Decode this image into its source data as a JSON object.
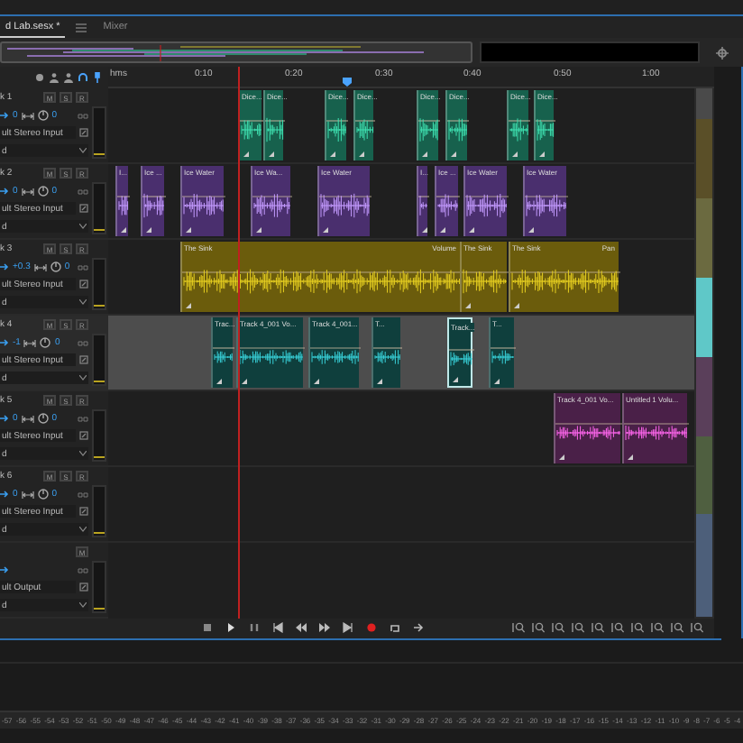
{
  "tabs": [
    {
      "label": "d Lab.sesx *",
      "selected": true
    },
    {
      "label": "Mixer",
      "selected": false
    }
  ],
  "ruler": [
    "hms",
    "0:10",
    "0:20",
    "0:30",
    "0:40",
    "0:50",
    "1:00"
  ],
  "tracks": [
    {
      "name": "k 1",
      "volume": "0",
      "pan": "0",
      "input": "ult Stereo Input",
      "mode": "d",
      "buttons": [
        "M",
        "S",
        "R"
      ],
      "color": "#17614d",
      "selected": false,
      "clips": [
        {
          "label": "Dice..."
        },
        {
          "label": "Dice..."
        },
        {
          "label": "Dice..."
        },
        {
          "label": "Dice..."
        },
        {
          "label": "Dice..."
        },
        {
          "label": "Dice..."
        },
        {
          "label": "Dice..."
        },
        {
          "label": "Dice..."
        }
      ]
    },
    {
      "name": "k 2",
      "volume": "0",
      "pan": "0",
      "input": "ult Stereo Input",
      "mode": "d",
      "buttons": [
        "M",
        "S",
        "R"
      ],
      "color": "#4a2f6e",
      "selected": false,
      "clips": [
        {
          "label": "I..."
        },
        {
          "label": "Ice ..."
        },
        {
          "label": "Ice Water"
        },
        {
          "label": "Ice Wa..."
        },
        {
          "label": "Ice Water"
        },
        {
          "label": "I..."
        },
        {
          "label": "Ice ..."
        },
        {
          "label": "Ice Water"
        },
        {
          "label": "Ice Water"
        }
      ]
    },
    {
      "name": "k 3",
      "volume": "+0.3",
      "pan": "0",
      "input": "ult Stereo Input",
      "mode": "d",
      "buttons": [
        "M",
        "S",
        "R"
      ],
      "color": "#6b5c0c",
      "selected": false,
      "clips": [
        {
          "label": "The Sink",
          "effect": "Volume"
        },
        {
          "label": "The Sink"
        },
        {
          "label": "The Sink",
          "effect": "Pan"
        }
      ]
    },
    {
      "name": "k 4",
      "volume": "-1",
      "pan": "0",
      "input": "ult Stereo Input",
      "mode": "d",
      "buttons": [
        "M",
        "S",
        "R"
      ],
      "color": "#0f3f3d",
      "selected": true,
      "clips": [
        {
          "label": "Trac..."
        },
        {
          "label": "Track 4_001 Vo..."
        },
        {
          "label": "Track 4_001..."
        },
        {
          "label": "T..."
        },
        {
          "label": "Track...",
          "selected": true
        },
        {
          "label": "T..."
        }
      ]
    },
    {
      "name": "k 5",
      "volume": "0",
      "pan": "0",
      "input": "ult Stereo Input",
      "mode": "d",
      "buttons": [
        "M",
        "S",
        "R"
      ],
      "color": "#4a2048",
      "selected": false,
      "clips": [
        {
          "label": "Track 4_001 Vo..."
        },
        {
          "label": "Untitled 1 Volu..."
        }
      ]
    },
    {
      "name": "k 6",
      "volume": "0",
      "pan": "0",
      "input": "ult Stereo Input",
      "mode": "d",
      "buttons": [
        "M",
        "S",
        "R"
      ],
      "selected": false
    }
  ],
  "output": {
    "input": "ult Output",
    "mode": "d",
    "buttons": [
      "M"
    ]
  },
  "meter_scale": [
    "-57",
    "-56",
    "-55",
    "-54",
    "-53",
    "-52",
    "-51",
    "-50",
    "-49",
    "-48",
    "-47",
    "-46",
    "-45",
    "-44",
    "-43",
    "-42",
    "-41",
    "-40",
    "-39",
    "-38",
    "-37",
    "-36",
    "-35",
    "-34",
    "-33",
    "-32",
    "-31",
    "-30",
    "-29",
    "-28",
    "-27",
    "-26",
    "-25",
    "-24",
    "-23",
    "-22",
    "-21",
    "-20",
    "-19",
    "-18",
    "-17",
    "-16",
    "-15",
    "-14",
    "-13",
    "-12",
    "-11",
    "-10",
    "-9",
    "-8",
    "-7",
    "-6",
    "-5",
    "-4"
  ]
}
